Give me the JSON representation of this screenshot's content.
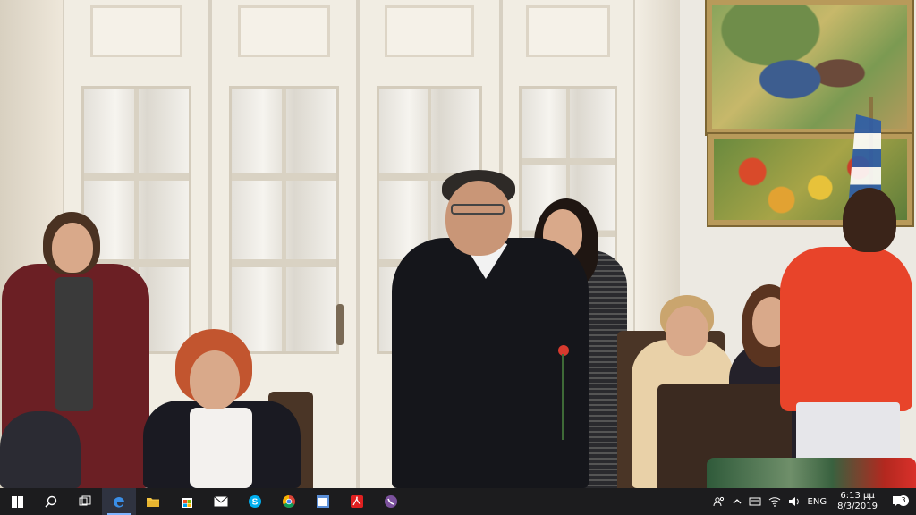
{
  "taskbar": {
    "apps": [
      {
        "id": "start",
        "icon": "windows-start-icon"
      },
      {
        "id": "search",
        "icon": "search-icon"
      },
      {
        "id": "task-view",
        "icon": "task-view-icon"
      },
      {
        "id": "edge",
        "icon": "edge-browser-icon"
      },
      {
        "id": "file-explorer",
        "icon": "folder-icon"
      },
      {
        "id": "store",
        "icon": "store-icon"
      },
      {
        "id": "mail",
        "icon": "mail-icon"
      },
      {
        "id": "skype",
        "icon": "skype-icon"
      },
      {
        "id": "chrome",
        "icon": "chrome-icon"
      },
      {
        "id": "app-window",
        "icon": "app-window-icon"
      },
      {
        "id": "acrobat",
        "icon": "acrobat-icon"
      },
      {
        "id": "viber",
        "icon": "viber-icon"
      }
    ],
    "active_app": "edge",
    "tray": {
      "language": "ENG",
      "time": "6:13 μμ",
      "date": "8/3/2019",
      "notification_count": "3"
    }
  },
  "colors": {
    "taskbar_bg": "#1c1c1e",
    "accent": "#7fb4ff",
    "flag_blue": "#2c5ca8",
    "red_top": "#e8442a"
  }
}
